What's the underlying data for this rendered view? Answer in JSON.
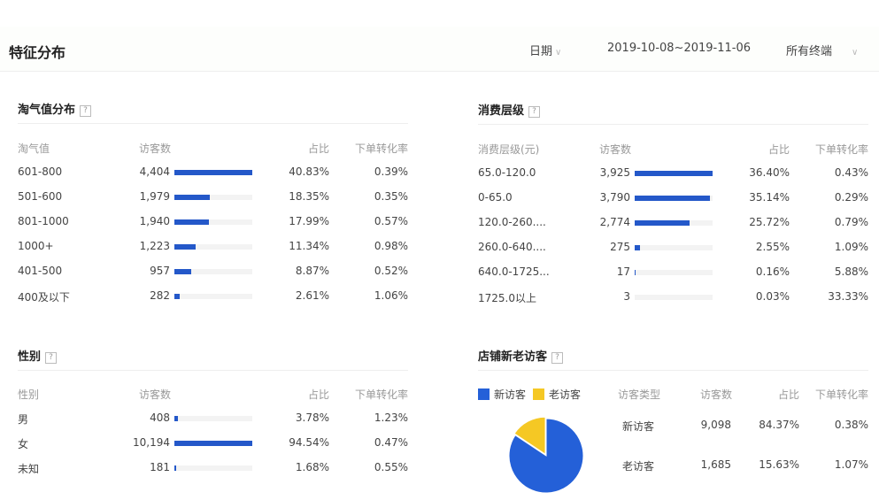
{
  "header": {
    "title": "特征分布",
    "date_label": "日期",
    "date_range": "2019-10-08~2019-11-06",
    "terminal": "所有终端"
  },
  "colors": {
    "accent": "#2458c9",
    "new": "#2460d8",
    "old": "#f5c824"
  },
  "taoqi": {
    "title": "淘气值分布",
    "help": "?",
    "columns": [
      "淘气值",
      "访客数",
      "占比",
      "下单转化率"
    ],
    "rows": [
      {
        "label": "601-800",
        "count": "4,404",
        "value": 4404,
        "ratio": "40.83%",
        "conv": "0.39%"
      },
      {
        "label": "501-600",
        "count": "1,979",
        "value": 1979,
        "ratio": "18.35%",
        "conv": "0.35%"
      },
      {
        "label": "801-1000",
        "count": "1,940",
        "value": 1940,
        "ratio": "17.99%",
        "conv": "0.57%"
      },
      {
        "label": "1000+",
        "count": "1,223",
        "value": 1223,
        "ratio": "11.34%",
        "conv": "0.98%"
      },
      {
        "label": "401-500",
        "count": "957",
        "value": 957,
        "ratio": "8.87%",
        "conv": "0.52%"
      },
      {
        "label": "400及以下",
        "count": "282",
        "value": 282,
        "ratio": "2.61%",
        "conv": "1.06%"
      }
    ]
  },
  "consume": {
    "title": "消费层级",
    "help": "?",
    "columns": [
      "消费层级(元)",
      "访客数",
      "占比",
      "下单转化率"
    ],
    "rows": [
      {
        "label": "65.0-120.0",
        "count": "3,925",
        "value": 3925,
        "ratio": "36.40%",
        "conv": "0.43%"
      },
      {
        "label": "0-65.0",
        "count": "3,790",
        "value": 3790,
        "ratio": "35.14%",
        "conv": "0.29%"
      },
      {
        "label": "120.0-260....",
        "count": "2,774",
        "value": 2774,
        "ratio": "25.72%",
        "conv": "0.79%"
      },
      {
        "label": "260.0-640....",
        "count": "275",
        "value": 275,
        "ratio": "2.55%",
        "conv": "1.09%"
      },
      {
        "label": "640.0-1725...",
        "count": "17",
        "value": 17,
        "ratio": "0.16%",
        "conv": "5.88%"
      },
      {
        "label": "1725.0以上",
        "count": "3",
        "value": 3,
        "ratio": "0.03%",
        "conv": "33.33%"
      }
    ]
  },
  "gender": {
    "title": "性别",
    "help": "?",
    "columns": [
      "性别",
      "访客数",
      "占比",
      "下单转化率"
    ],
    "rows": [
      {
        "label": "男",
        "count": "408",
        "value": 408,
        "ratio": "3.78%",
        "conv": "1.23%"
      },
      {
        "label": "女",
        "count": "10,194",
        "value": 10194,
        "ratio": "94.54%",
        "conv": "0.47%"
      },
      {
        "label": "未知",
        "count": "181",
        "value": 181,
        "ratio": "1.68%",
        "conv": "0.55%"
      }
    ]
  },
  "visitors": {
    "title": "店铺新老访客",
    "help": "?",
    "legend": [
      "新访客",
      "老访客"
    ],
    "columns": [
      "访客类型",
      "访客数",
      "占比",
      "下单转化率"
    ],
    "rows": [
      {
        "label": "新访客",
        "count": "9,098",
        "ratio": "84.37%",
        "conv": "0.38%",
        "percent": 84.37
      },
      {
        "label": "老访客",
        "count": "1,685",
        "ratio": "15.63%",
        "conv": "1.07%",
        "percent": 15.63
      }
    ]
  }
}
